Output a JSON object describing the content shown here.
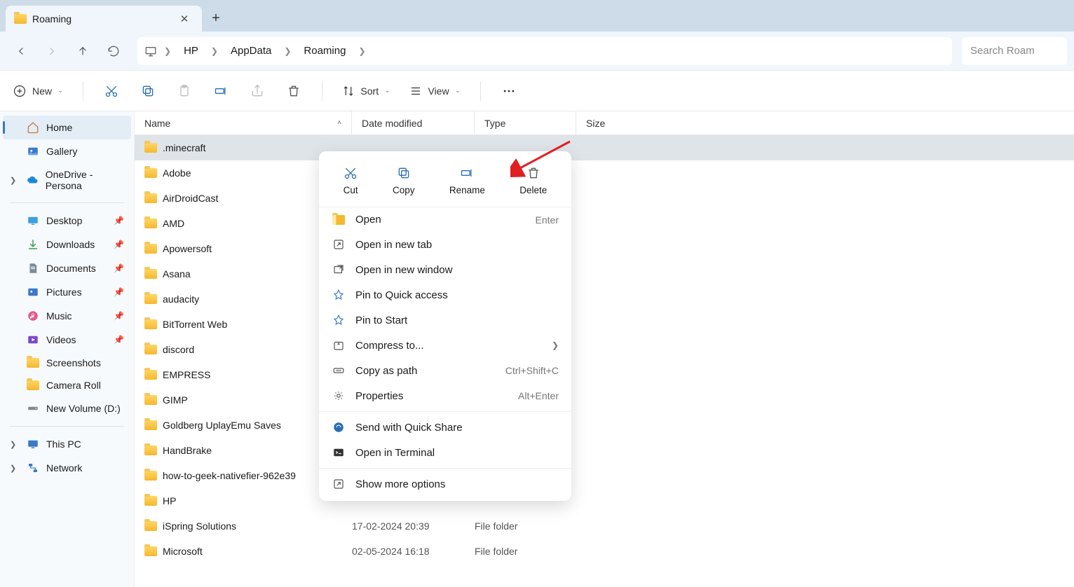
{
  "tab": {
    "title": "Roaming"
  },
  "breadcrumb": [
    "HP",
    "AppData",
    "Roaming"
  ],
  "search": {
    "placeholder": "Search Roam"
  },
  "toolbar": {
    "new": "New",
    "sort": "Sort",
    "view": "View"
  },
  "sidebar": {
    "top": [
      {
        "label": "Home",
        "icon": "home",
        "active": true
      },
      {
        "label": "Gallery",
        "icon": "gallery"
      },
      {
        "label": "OneDrive - Persona",
        "icon": "onedrive",
        "expandable": true
      }
    ],
    "pinned": [
      {
        "label": "Desktop",
        "icon": "desktop",
        "pin": true
      },
      {
        "label": "Downloads",
        "icon": "downloads",
        "pin": true
      },
      {
        "label": "Documents",
        "icon": "documents",
        "pin": true
      },
      {
        "label": "Pictures",
        "icon": "pictures",
        "pin": true
      },
      {
        "label": "Music",
        "icon": "music",
        "pin": true
      },
      {
        "label": "Videos",
        "icon": "videos",
        "pin": true
      },
      {
        "label": "Screenshots",
        "icon": "folder"
      },
      {
        "label": "Camera Roll",
        "icon": "folder"
      },
      {
        "label": "New Volume (D:)",
        "icon": "drive"
      }
    ],
    "bottom": [
      {
        "label": "This PC",
        "icon": "pc",
        "expandable": true
      },
      {
        "label": "Network",
        "icon": "network",
        "expandable": true
      }
    ]
  },
  "columns": {
    "name": "Name",
    "date": "Date modified",
    "type": "Type",
    "size": "Size"
  },
  "files": [
    {
      "name": ".minecraft",
      "date": "",
      "type": "",
      "selected": true
    },
    {
      "name": "Adobe"
    },
    {
      "name": "AirDroidCast"
    },
    {
      "name": "AMD"
    },
    {
      "name": "Apowersoft"
    },
    {
      "name": "Asana"
    },
    {
      "name": "audacity"
    },
    {
      "name": "BitTorrent Web"
    },
    {
      "name": "discord"
    },
    {
      "name": "EMPRESS"
    },
    {
      "name": "GIMP"
    },
    {
      "name": "Goldberg UplayEmu Saves"
    },
    {
      "name": "HandBrake"
    },
    {
      "name": "how-to-geek-nativefier-962e39"
    },
    {
      "name": "HP"
    },
    {
      "name": "iSpring Solutions",
      "date": "17-02-2024 20:39",
      "type": "File folder"
    },
    {
      "name": "Microsoft",
      "date": "02-05-2024 16:18",
      "type": "File folder"
    }
  ],
  "context_menu": {
    "top": [
      {
        "label": "Cut",
        "icon": "cut"
      },
      {
        "label": "Copy",
        "icon": "copy"
      },
      {
        "label": "Rename",
        "icon": "rename"
      },
      {
        "label": "Delete",
        "icon": "delete"
      }
    ],
    "items": [
      {
        "label": "Open",
        "icon": "folder-open",
        "shortcut": "Enter"
      },
      {
        "label": "Open in new tab",
        "icon": "newtab"
      },
      {
        "label": "Open in new window",
        "icon": "newwin"
      },
      {
        "label": "Pin to Quick access",
        "icon": "pin"
      },
      {
        "label": "Pin to Start",
        "icon": "pin"
      },
      {
        "label": "Compress to...",
        "icon": "zip",
        "submenu": true
      },
      {
        "label": "Copy as path",
        "icon": "path",
        "shortcut": "Ctrl+Shift+C"
      },
      {
        "label": "Properties",
        "icon": "props",
        "shortcut": "Alt+Enter"
      },
      {
        "sep": true
      },
      {
        "label": "Send with Quick Share",
        "icon": "quickshare"
      },
      {
        "label": "Open in Terminal",
        "icon": "terminal"
      },
      {
        "sep": true
      },
      {
        "label": "Show more options",
        "icon": "more"
      }
    ]
  }
}
